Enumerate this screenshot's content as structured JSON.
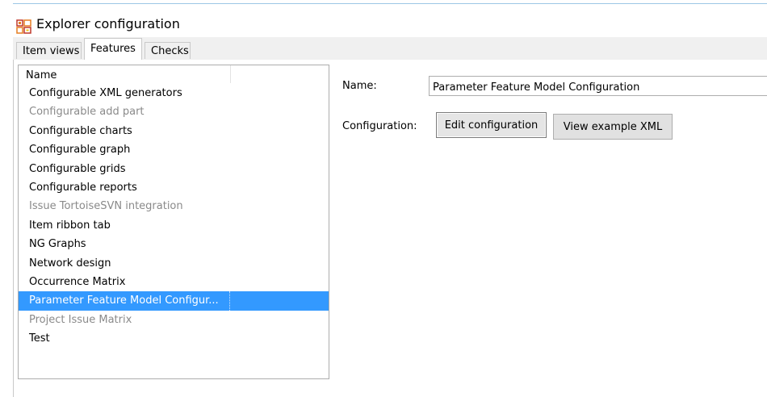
{
  "window": {
    "title": "Explorer configuration"
  },
  "tabs": [
    {
      "label": "Item views"
    },
    {
      "label": "Features"
    },
    {
      "label": "Checks"
    }
  ],
  "list": {
    "header": "Name",
    "items": [
      {
        "label": "Configurable XML generators",
        "state": "enabled"
      },
      {
        "label": "Configurable add part",
        "state": "disabled"
      },
      {
        "label": "Configurable charts",
        "state": "enabled"
      },
      {
        "label": "Configurable graph",
        "state": "enabled"
      },
      {
        "label": "Configurable grids",
        "state": "enabled"
      },
      {
        "label": "Configurable reports",
        "state": "enabled"
      },
      {
        "label": "Issue TortoiseSVN integration",
        "state": "disabled"
      },
      {
        "label": "Item ribbon tab",
        "state": "enabled"
      },
      {
        "label": "NG Graphs",
        "state": "enabled"
      },
      {
        "label": "Network design",
        "state": "enabled"
      },
      {
        "label": "Occurrence Matrix",
        "state": "enabled"
      },
      {
        "label": "Parameter Feature Model Configur...",
        "state": "selected"
      },
      {
        "label": "Project Issue Matrix",
        "state": "disabled"
      },
      {
        "label": "Test",
        "state": "enabled"
      }
    ]
  },
  "details": {
    "name_label": "Name:",
    "name_value": "Parameter Feature Model Configuration",
    "configuration_label": "Configuration:",
    "edit_button": "Edit configuration",
    "view_button": "View example XML"
  },
  "colors": {
    "selection": "#3399ff",
    "disabled_text": "#8a8a8a",
    "tab_bg": "#f0f0f0"
  },
  "icons": {
    "title": "gears-icon"
  }
}
